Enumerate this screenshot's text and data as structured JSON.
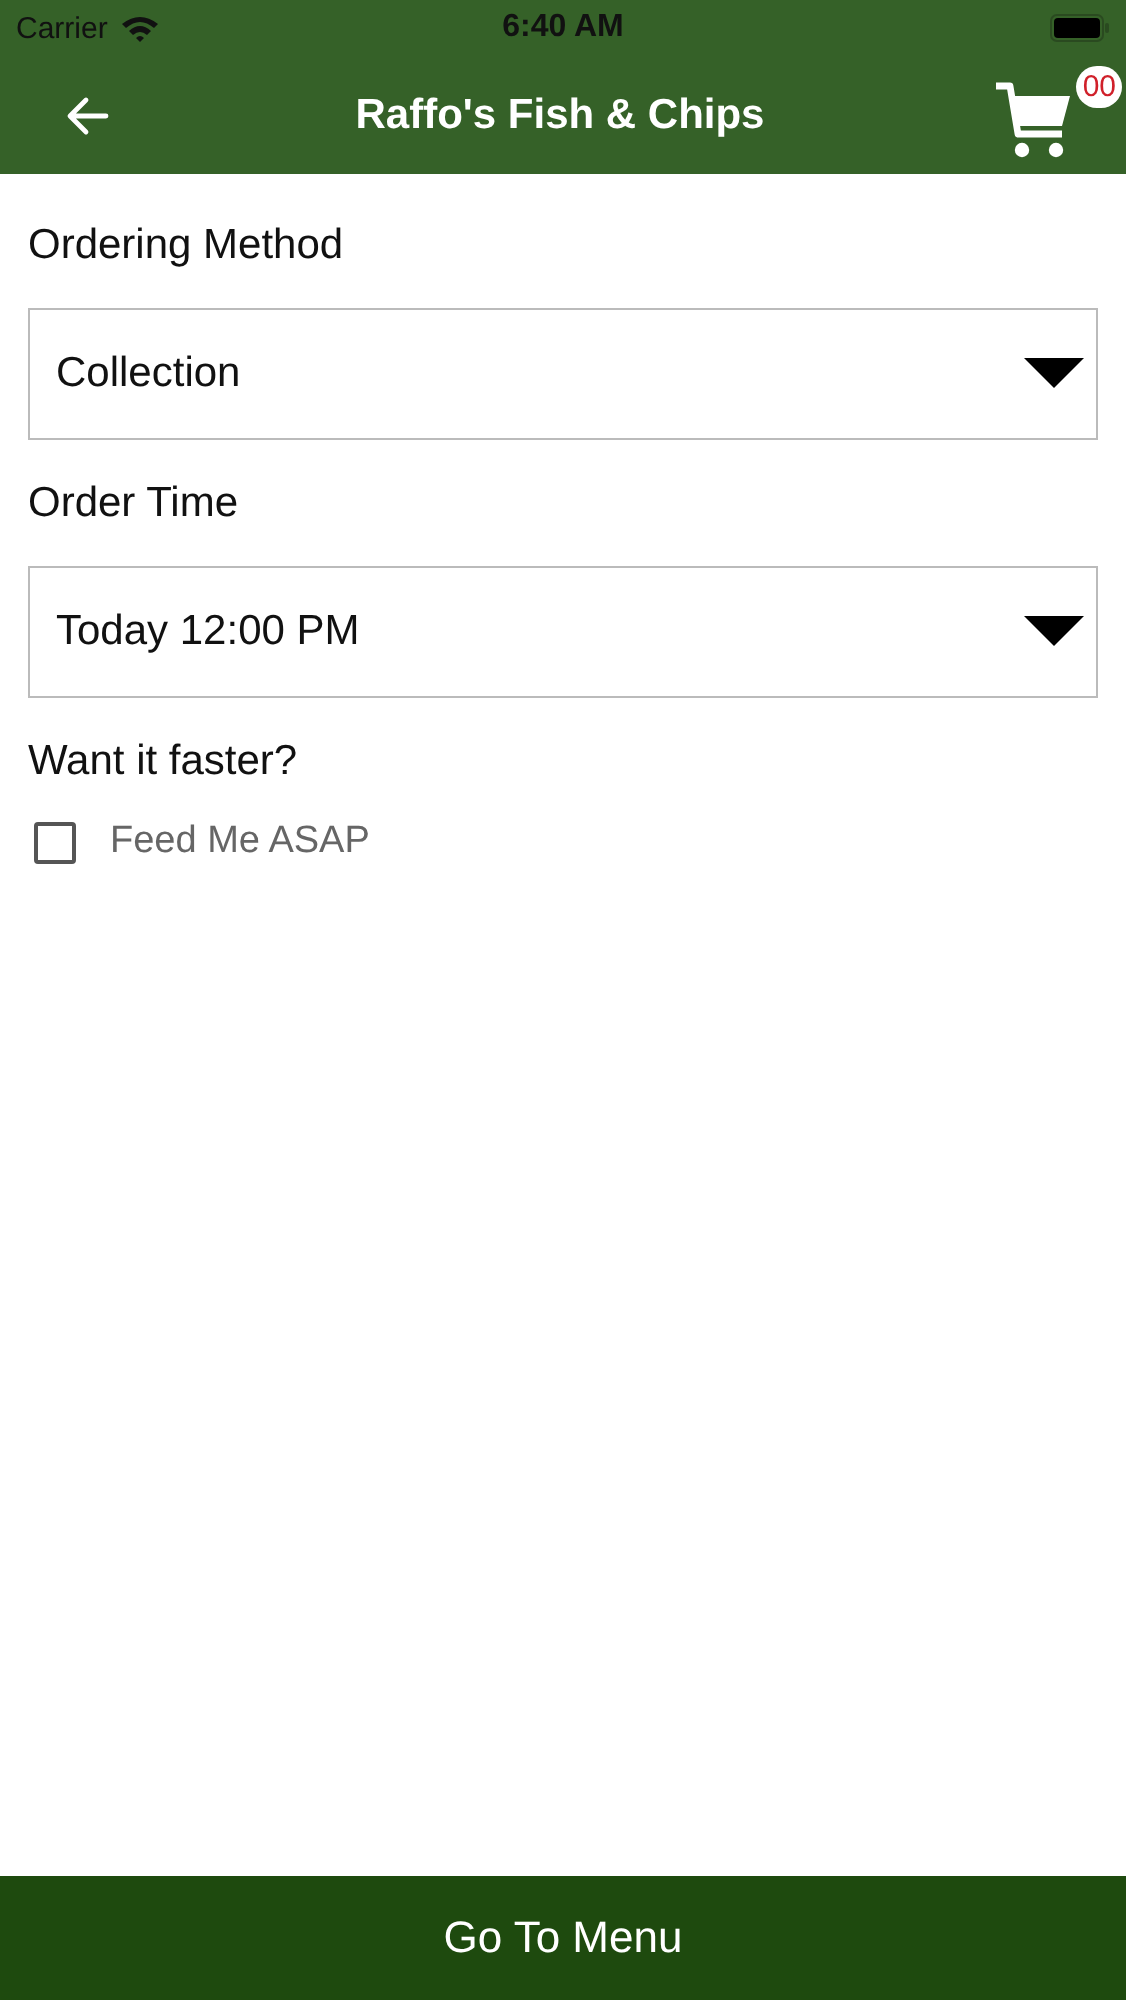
{
  "status_bar": {
    "carrier": "Carrier",
    "time": "6:40 AM"
  },
  "nav": {
    "title": "Raffo's Fish & Chips",
    "cart_count": "00"
  },
  "fields": [
    {
      "label": "Ordering Method",
      "value": "Collection"
    },
    {
      "label": "Order Time",
      "value": "Today 12:00 PM"
    }
  ],
  "faster": {
    "heading": "Want it faster?",
    "option": {
      "label": "Feed Me ASAP",
      "checked": false
    }
  },
  "footer_button": "Go To Menu"
}
